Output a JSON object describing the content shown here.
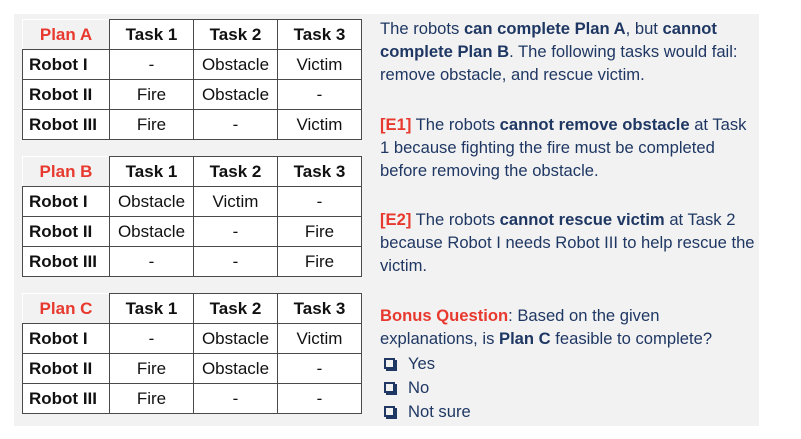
{
  "tasks": [
    "Task 1",
    "Task 2",
    "Task 3"
  ],
  "plans": [
    {
      "name": "Plan A",
      "rows": [
        {
          "robot": "Robot I",
          "cells": [
            "-",
            "Obstacle",
            "Victim"
          ]
        },
        {
          "robot": "Robot II",
          "cells": [
            "Fire",
            "Obstacle",
            "-"
          ]
        },
        {
          "robot": "Robot III",
          "cells": [
            "Fire",
            "-",
            "Victim"
          ]
        }
      ]
    },
    {
      "name": "Plan B",
      "rows": [
        {
          "robot": "Robot I",
          "cells": [
            "Obstacle",
            "Victim",
            "-"
          ]
        },
        {
          "robot": "Robot II",
          "cells": [
            "Obstacle",
            "-",
            "Fire"
          ]
        },
        {
          "robot": "Robot III",
          "cells": [
            "-",
            "-",
            "Fire"
          ]
        }
      ]
    },
    {
      "name": "Plan C",
      "rows": [
        {
          "robot": "Robot I",
          "cells": [
            "-",
            "Obstacle",
            "Victim"
          ]
        },
        {
          "robot": "Robot II",
          "cells": [
            "Fire",
            "Obstacle",
            "-"
          ]
        },
        {
          "robot": "Robot III",
          "cells": [
            "Fire",
            "-",
            "-"
          ]
        }
      ]
    }
  ],
  "summary": {
    "t1": "The robots ",
    "b1": "can complete Plan A",
    "t2": ", but ",
    "b2": "cannot complete Plan B",
    "t3": ". The following tasks would fail: remove obstacle, and rescue victim."
  },
  "e1": {
    "tag": "[E1]",
    "t1": " The robots ",
    "b1": "cannot remove obstacle",
    "t2": " at Task 1 because fighting the fire must be completed before removing the obstacle."
  },
  "e2": {
    "tag": "[E2]",
    "t1": " The robots ",
    "b1": "cannot rescue victim",
    "t2": " at Task 2 because Robot I needs Robot III to help rescue the victim."
  },
  "bonus": {
    "tag": "Bonus Question",
    "t1": ": Based on the given explanations, is ",
    "b1": "Plan C",
    "t2": " feasible to complete?",
    "options": [
      "Yes",
      "No",
      "Not sure"
    ]
  },
  "colors": {
    "accent_red": "#e8392f",
    "text_navy": "#1f3763",
    "panel_bg": "#f2f2f2"
  }
}
